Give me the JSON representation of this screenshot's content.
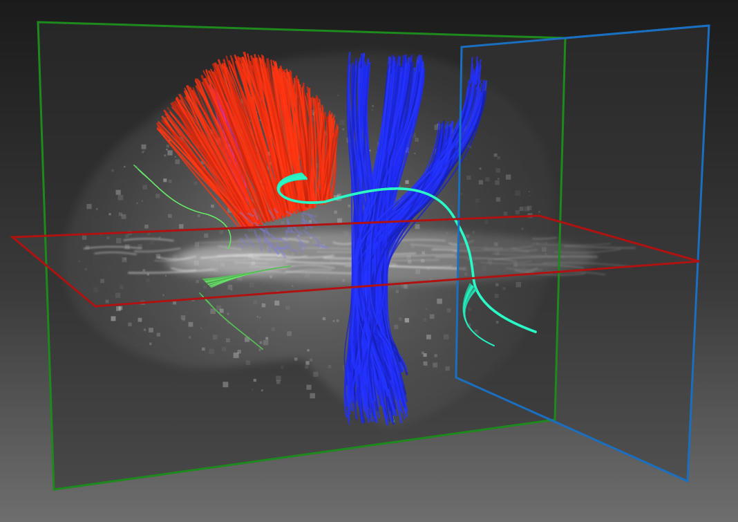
{
  "scene": {
    "type": "3d-tractography-viewport",
    "background_top": "#1b1b1b",
    "background_bottom": "#6e6e6e",
    "planes": [
      {
        "name": "sagittal",
        "border_color": "#1e8a1e"
      },
      {
        "name": "axial",
        "border_color": "#b01212"
      },
      {
        "name": "coronal",
        "border_color": "#1a6fc0"
      }
    ],
    "bundles": [
      {
        "name": "corticospinal",
        "color": "#1f2cf5"
      },
      {
        "name": "corpus-callosum-fan",
        "color": "#ff3010"
      },
      {
        "name": "arcuate",
        "color": "#23c8a0"
      },
      {
        "name": "association-green",
        "color": "#5ac05a"
      },
      {
        "name": "association-magenta",
        "color": "#e02a8a"
      }
    ],
    "mri_slice_tone": "#9a9a9a"
  }
}
